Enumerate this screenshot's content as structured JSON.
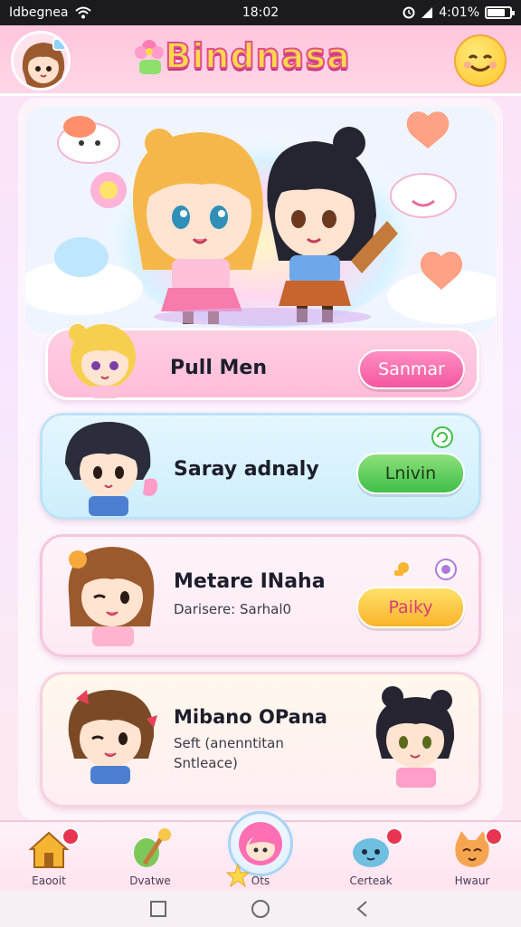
{
  "status_bar": {
    "carrier": "Idbegnea",
    "time": "18:02",
    "battery_text": "4:01%",
    "battery_level": 0.72
  },
  "header": {
    "title": "Bindnasa"
  },
  "cards": [
    {
      "name": "Pull Men",
      "button": "Sanmar"
    },
    {
      "name": "Saray adnaly",
      "button": "Lnivin"
    },
    {
      "name": "Metare INaha",
      "subtitle": "Darisere: Sarhal0",
      "button": "Paiky"
    },
    {
      "name": "Mibano OPana",
      "subtitle_line1": "Seft (anenntitan",
      "subtitle_line2": "Sntleace)"
    }
  ],
  "bottom_nav": [
    {
      "label": "Eaooit",
      "icon": "house-icon",
      "badge": true
    },
    {
      "label": "Dvatwe",
      "icon": "magic-wand-icon",
      "badge": false
    },
    {
      "label": "Ots",
      "icon": "profile-center-icon",
      "badge": false
    },
    {
      "label": "Certeak",
      "icon": "blob-pet-icon",
      "badge": true
    },
    {
      "label": "Hwaur",
      "icon": "cat-icon",
      "badge": true
    }
  ],
  "colors": {
    "accent_pink": "#f5579e",
    "accent_green": "#3fbf4a",
    "accent_yellow": "#fbb42a",
    "header_pink": "#ffc5dd"
  }
}
